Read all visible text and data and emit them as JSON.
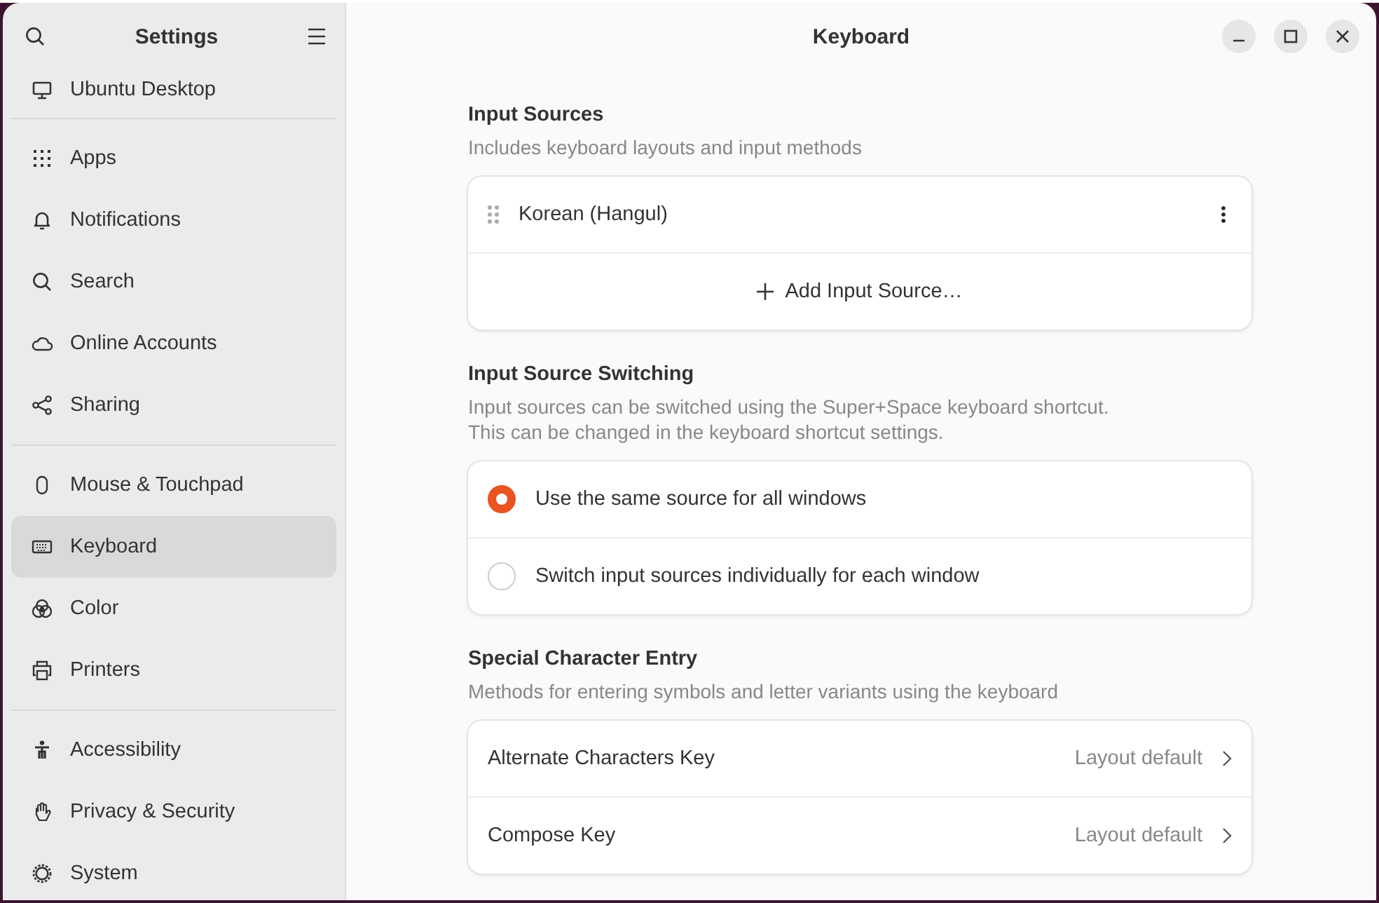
{
  "sidebar": {
    "title": "Settings",
    "groups": [
      [
        {
          "label": "Ubuntu Desktop",
          "selected": false
        }
      ],
      [
        {
          "label": "Apps",
          "selected": false
        },
        {
          "label": "Notifications",
          "selected": false
        },
        {
          "label": "Search",
          "selected": false
        },
        {
          "label": "Online Accounts",
          "selected": false
        },
        {
          "label": "Sharing",
          "selected": false
        }
      ],
      [
        {
          "label": "Mouse & Touchpad",
          "selected": false
        },
        {
          "label": "Keyboard",
          "selected": true
        },
        {
          "label": "Color",
          "selected": false
        },
        {
          "label": "Printers",
          "selected": false
        }
      ],
      [
        {
          "label": "Accessibility",
          "selected": false
        },
        {
          "label": "Privacy & Security",
          "selected": false
        },
        {
          "label": "System",
          "selected": false
        }
      ]
    ]
  },
  "window": {
    "title": "Keyboard"
  },
  "input_sources": {
    "title": "Input Sources",
    "subtitle": "Includes keyboard layouts and input methods",
    "items": [
      "Korean (Hangul)"
    ],
    "add_button": "Add Input Source…"
  },
  "switching": {
    "title": "Input Source Switching",
    "subtitle": [
      "Input sources can be switched using the Super+Space keyboard shortcut.",
      "This can be changed in the keyboard shortcut settings."
    ],
    "options": [
      {
        "label": "Use the same source for all windows",
        "selected": true
      },
      {
        "label": "Switch input sources individually for each window",
        "selected": false
      }
    ]
  },
  "special_characters": {
    "title": "Special Character Entry",
    "subtitle": "Methods for entering symbols and letter variants using the keyboard",
    "rows": [
      {
        "label": "Alternate Characters Key",
        "value": "Layout default"
      },
      {
        "label": "Compose Key",
        "value": "Layout default"
      }
    ]
  }
}
